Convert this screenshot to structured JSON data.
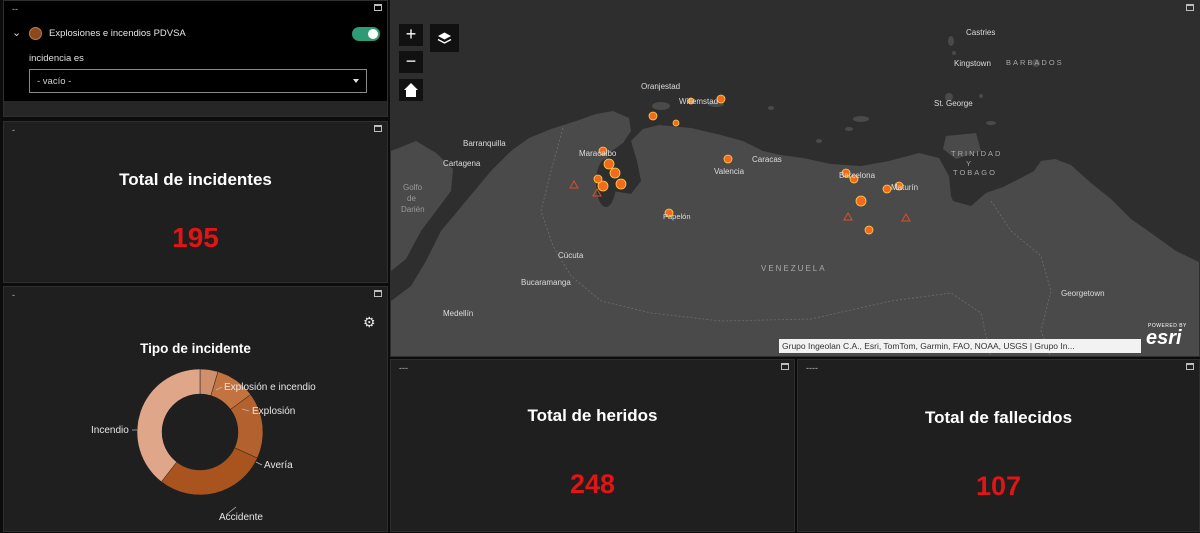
{
  "filter_panel": {
    "title": "--",
    "layer_name": "Explosiones e incendios PDVSA",
    "toggle_on": true,
    "filter_label": "incidencia es",
    "select_value": "- vacío -",
    "layer_color": "#8a4a1e"
  },
  "total_incidentes": {
    "title": "-",
    "label": "Total de incidentes",
    "value": "195"
  },
  "tipo_incidente": {
    "title": "-",
    "label": "Tipo de incidente",
    "chart_data": {
      "type": "pie",
      "title": "Tipo de incidente",
      "categories": [
        "Explosión e incendio",
        "Explosión",
        "Avería",
        "Accidente",
        "Incendio"
      ],
      "values": [
        9,
        20,
        33,
        56,
        77
      ],
      "colors": [
        "#d0906c",
        "#c2733f",
        "#b3622f",
        "#a9531f",
        "#dfa689"
      ],
      "donut": true
    }
  },
  "map": {
    "title": "",
    "labels": {
      "castries": "Castries",
      "kingstown": "Kingstown",
      "barbados": "BARBADOS",
      "oranjestad": "Oranjestad",
      "willemstad": "Willemstad",
      "st_george": "St. George",
      "barranquilla": "Barranquilla",
      "maracaibo": "Maracaibo",
      "trinidad": "TRINIDAD",
      "y": "Y",
      "tobago": "TOBAGO",
      "cartagena": "Cartagena",
      "caracas": "Caracas",
      "valencia": "Valencia",
      "barcelona": "Barcelona",
      "maturin": "Maturín",
      "golfo": "Golfo",
      "de": "de",
      "darien": "Darién",
      "papelon": "Papelón",
      "cucuta": "Cúcuta",
      "venezuela": "VENEZUELA",
      "bucaramanga": "Bucaramanga",
      "georgetown": "Georgetown",
      "medellin": "Medellín"
    },
    "attribution": "Grupo Ingeolan C.A., Esri, TomTom, Garmin, FAO, NOAA, USGS | Grupo In...",
    "esri_powered": "POWERED BY",
    "esri_logo": "esri",
    "zoom_in": "+",
    "zoom_out": "−"
  },
  "total_heridos": {
    "title": "---",
    "label": "Total de heridos",
    "value": "248"
  },
  "total_fallecidos": {
    "title": "----",
    "label": "Total de fallecidos",
    "value": "107"
  }
}
